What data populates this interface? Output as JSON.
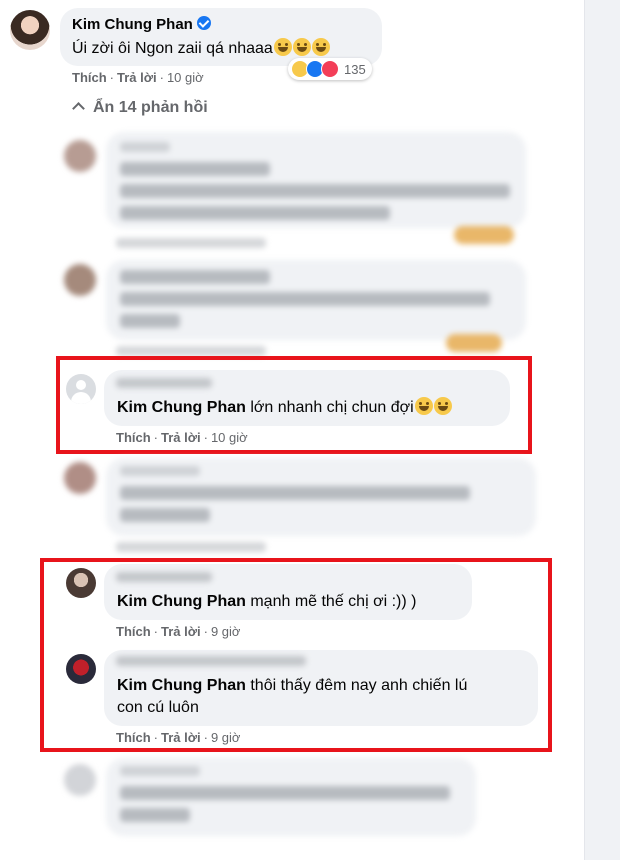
{
  "top_comment": {
    "author": "Kim Chung Phan",
    "text": "Úi zời ôi Ngon zaii qá nhaaa",
    "actions": {
      "like": "Thích",
      "reply": "Trả lời",
      "time": "10 giờ"
    },
    "reaction_count": "135"
  },
  "hide_replies": "Ẩn 14 phản hồi",
  "highlighted_replies": [
    {
      "mention": "Kim Chung Phan",
      "text": "lớn nhanh chị chun đợi",
      "like": "Thích",
      "reply": "Trả lời",
      "time": "10 giờ"
    },
    {
      "mention": "Kim Chung Phan",
      "text": "mạnh mẽ thế chị ơi :)) )",
      "like": "Thích",
      "reply": "Trả lời",
      "time": "9 giờ"
    },
    {
      "mention": "Kim Chung Phan",
      "text_line1": "thôi thấy đêm nay anh chiến lú",
      "text_line2": "con cú luôn",
      "like": "Thích",
      "reply": "Trả lời",
      "time": "9 giờ"
    }
  ],
  "colors": {
    "highlight": "#e8141b",
    "bubble": "#f0f2f5",
    "verified": "#1877f2",
    "meta": "#65676b"
  }
}
